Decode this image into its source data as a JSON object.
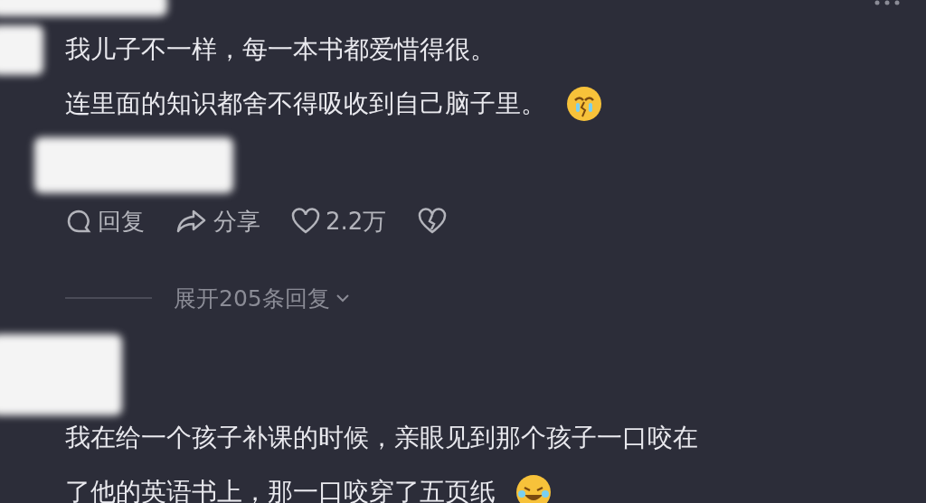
{
  "comments": [
    {
      "lines": [
        "我儿子不一样，每一本书都爱惜得很。",
        "连里面的知识都舍不得吸收到自己脑子里。"
      ],
      "emoji": {
        "kind": "sad"
      },
      "actions": {
        "reply": "回复",
        "share": "分享",
        "likes": "2.2万"
      },
      "expand": "展开205条回复"
    },
    {
      "lines": [
        "我在给一个孩子补课的时候，亲眼见到那个孩子一口咬在",
        "了他的英语书上，那一口咬穿了五页纸"
      ],
      "emoji": {
        "kind": "laugh"
      }
    }
  ]
}
